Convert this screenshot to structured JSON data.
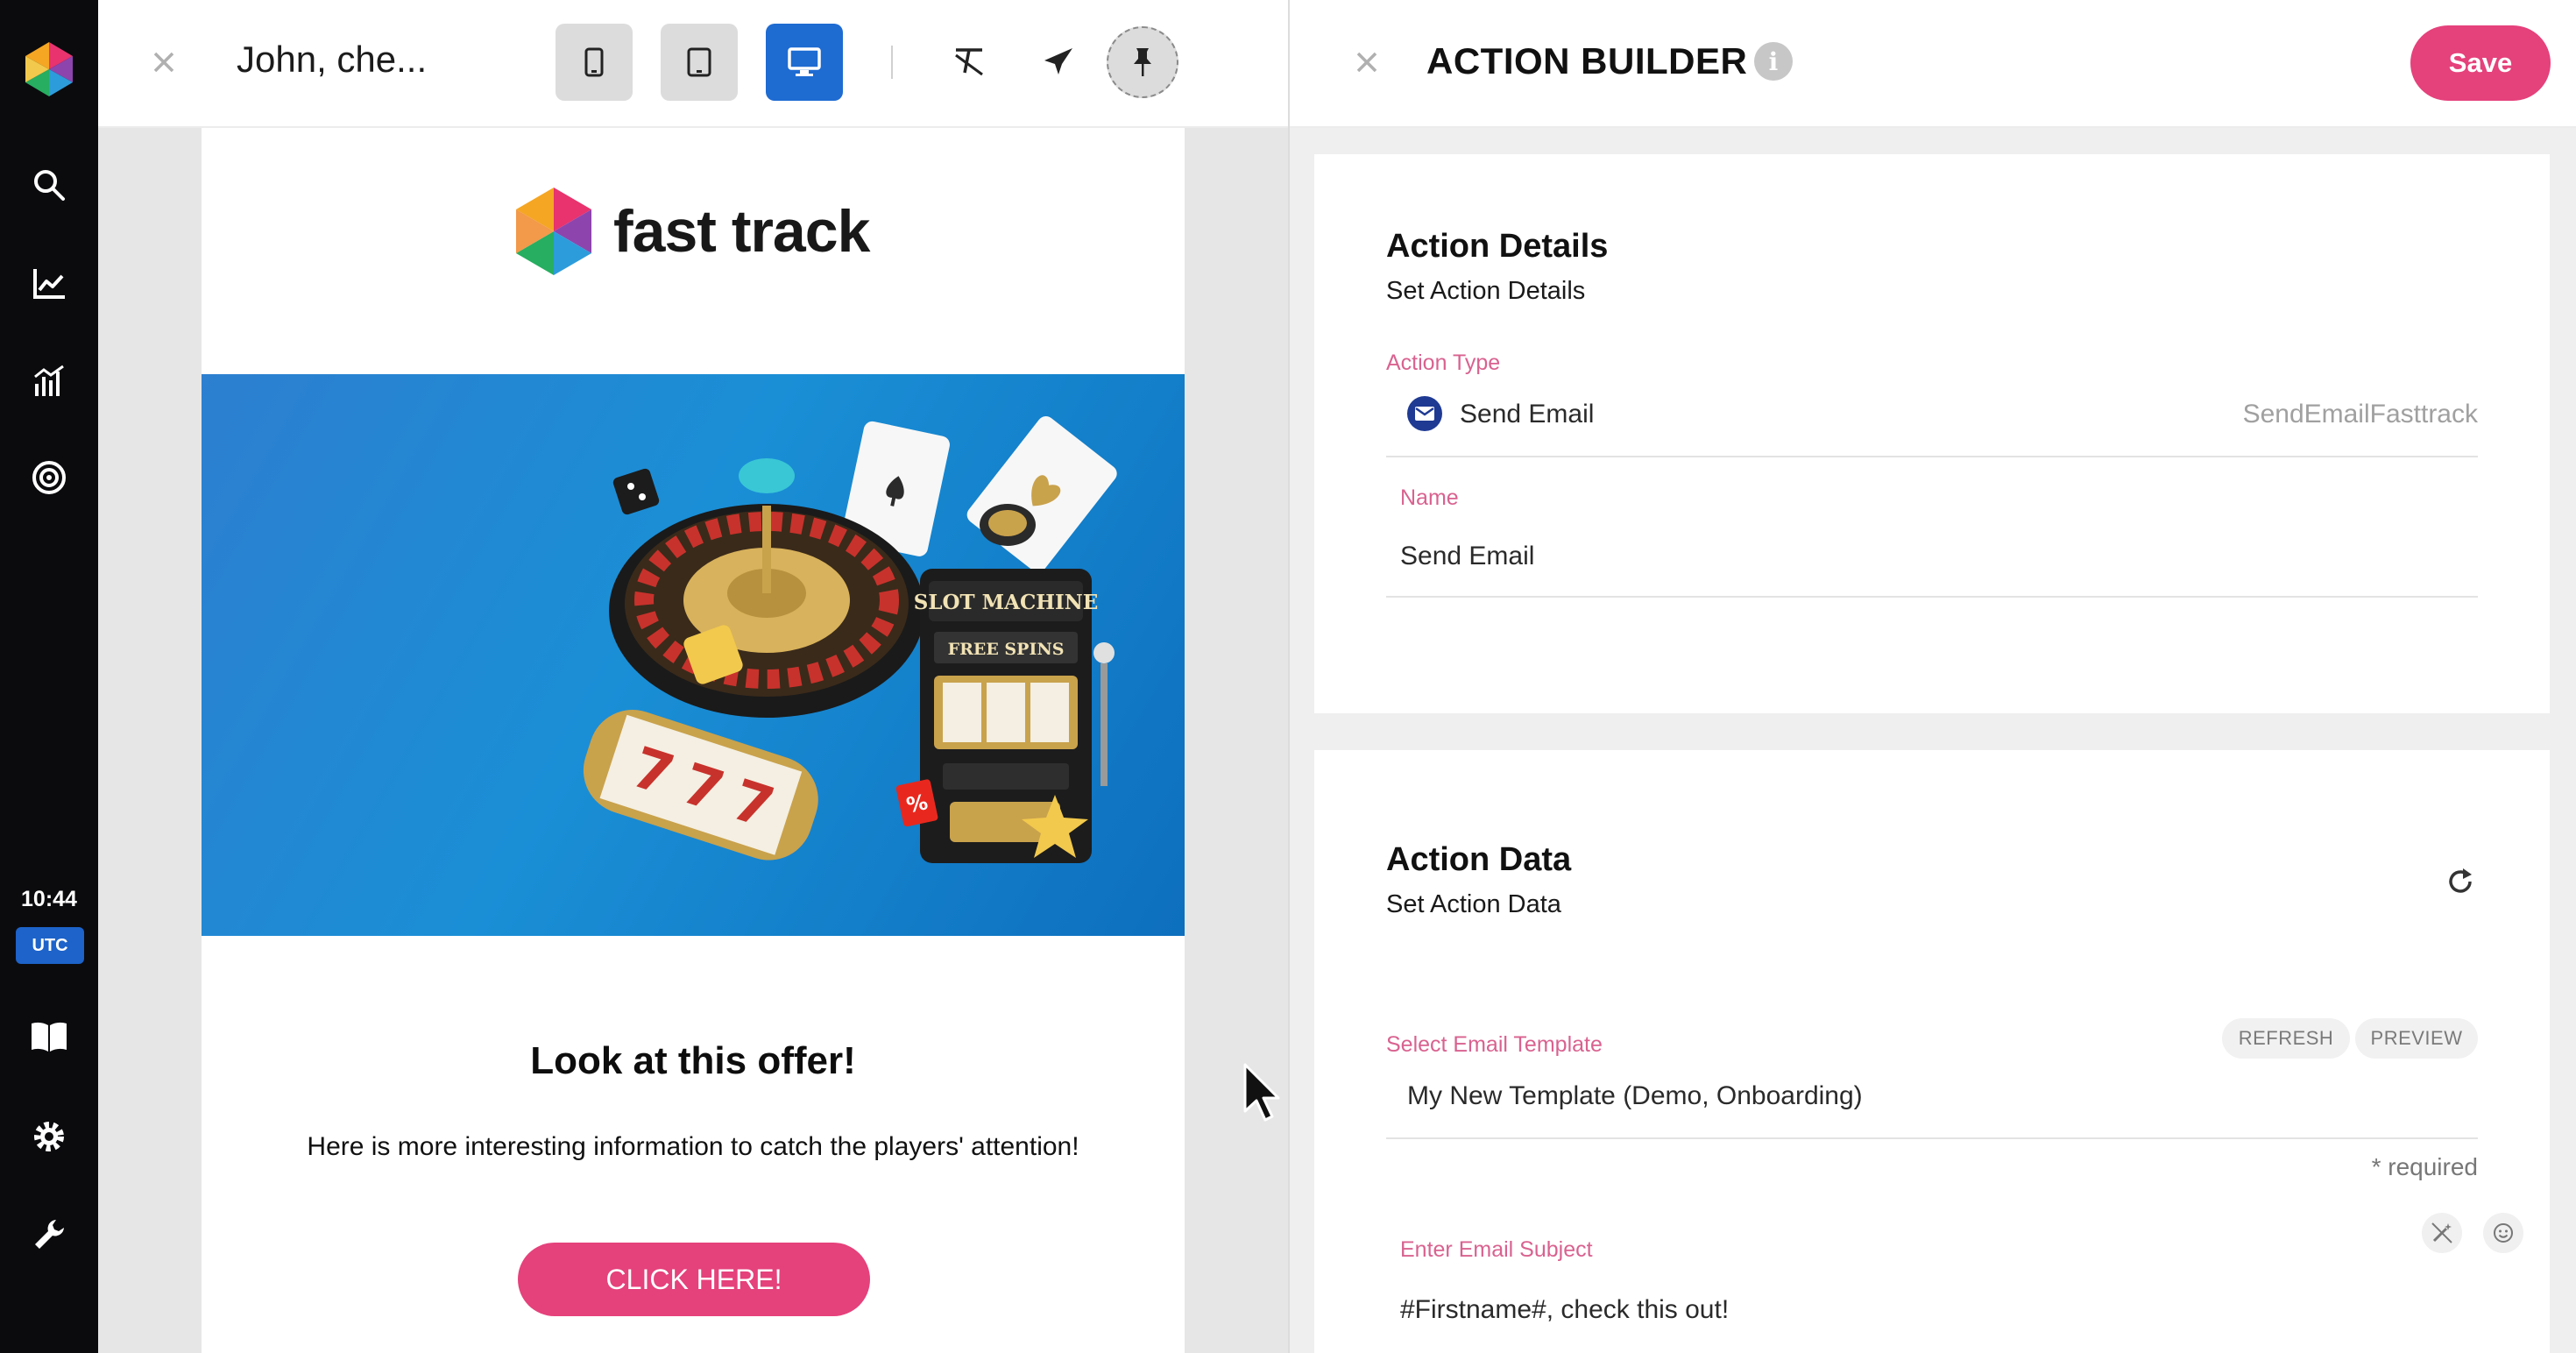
{
  "rail": {
    "time": "10:44",
    "timezone": "UTC"
  },
  "preview": {
    "title": "John, che...",
    "email": {
      "brand": "fast track",
      "headline": "Look at this offer!",
      "body": "Here is more interesting information to catch the players' attention!",
      "cta": "CLICK HERE!",
      "banner_texts": [
        "SLOT MACHINE",
        "FREE SPINS"
      ]
    }
  },
  "builder": {
    "title": "ACTION BUILDER",
    "info_glyph": "i",
    "save": "Save",
    "details": {
      "title": "Action Details",
      "subtitle": "Set Action Details",
      "action_type_label": "Action Type",
      "action_type_value": "Send Email",
      "action_type_code": "SendEmailFasttrack",
      "name_label": "Name",
      "name_value": "Send Email"
    },
    "data": {
      "title": "Action Data",
      "subtitle": "Set Action Data",
      "template_label": "Select Email Template",
      "refresh": "REFRESH",
      "preview": "PREVIEW",
      "template_value": "My New Template (Demo, Onboarding)",
      "required": "* required",
      "subject_label": "Enter Email Subject",
      "subject_value": "#Firstname#, check this out!"
    }
  },
  "colors": {
    "accent": "#e5417b",
    "device_active": "#1e6bd2",
    "label": "#d9628f",
    "rail": "#0b0b0e",
    "utc_badge": "#1d63c9"
  }
}
